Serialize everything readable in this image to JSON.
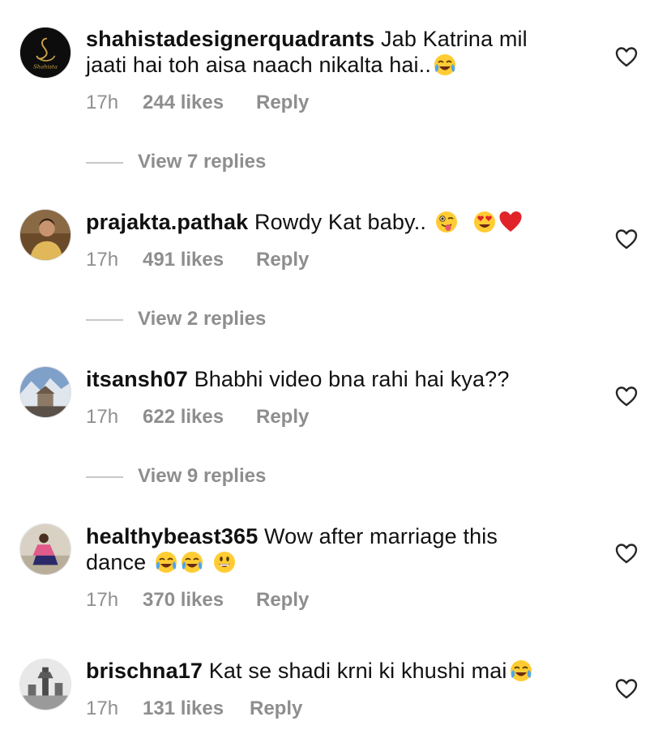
{
  "comments": [
    {
      "username": "shahistadesignerquadrants",
      "text_line1": " Jab Katrina mil",
      "text_line2": "jaati hai toh aisa naach nikalta hai..",
      "time": "17h",
      "likes": "244 likes",
      "reply": "Reply",
      "view_replies": "View 7 replies",
      "avatar_logo_text": "Shahista"
    },
    {
      "username": "prajakta.pathak",
      "text": " Rowdy Kat baby.. ",
      "time": "17h",
      "likes": "491 likes",
      "reply": "Reply",
      "view_replies": "View 2 replies"
    },
    {
      "username": "itsansh07",
      "text": " Bhabhi video bna rahi hai kya??",
      "time": "17h",
      "likes": "622 likes",
      "reply": "Reply",
      "view_replies": "View 9 replies"
    },
    {
      "username": "healthybeast365",
      "text_line1": " Wow after marriage this",
      "text_line2": "dance ",
      "time": "17h",
      "likes": "370 likes",
      "reply": "Reply"
    },
    {
      "username": "brischna17",
      "text": " Kat se shadi krni ki khushi mai",
      "time": "17h",
      "likes": "131 likes",
      "reply": "Reply"
    }
  ],
  "colors": {
    "meta": "#8e8e8e",
    "divider": "#c7c7c7",
    "heart": "#262626",
    "emoji_face": "#ffcc33",
    "emoji_red": "#e0242a"
  },
  "icons": {
    "like": "heart-outline-icon",
    "laugh": "face-with-tears-of-joy-emoji",
    "wink_tongue": "winking-face-with-tongue-emoji",
    "heart_eyes": "smiling-face-with-heart-eyes-emoji",
    "red_heart": "red-heart-emoji",
    "grin": "grinning-face-emoji"
  }
}
